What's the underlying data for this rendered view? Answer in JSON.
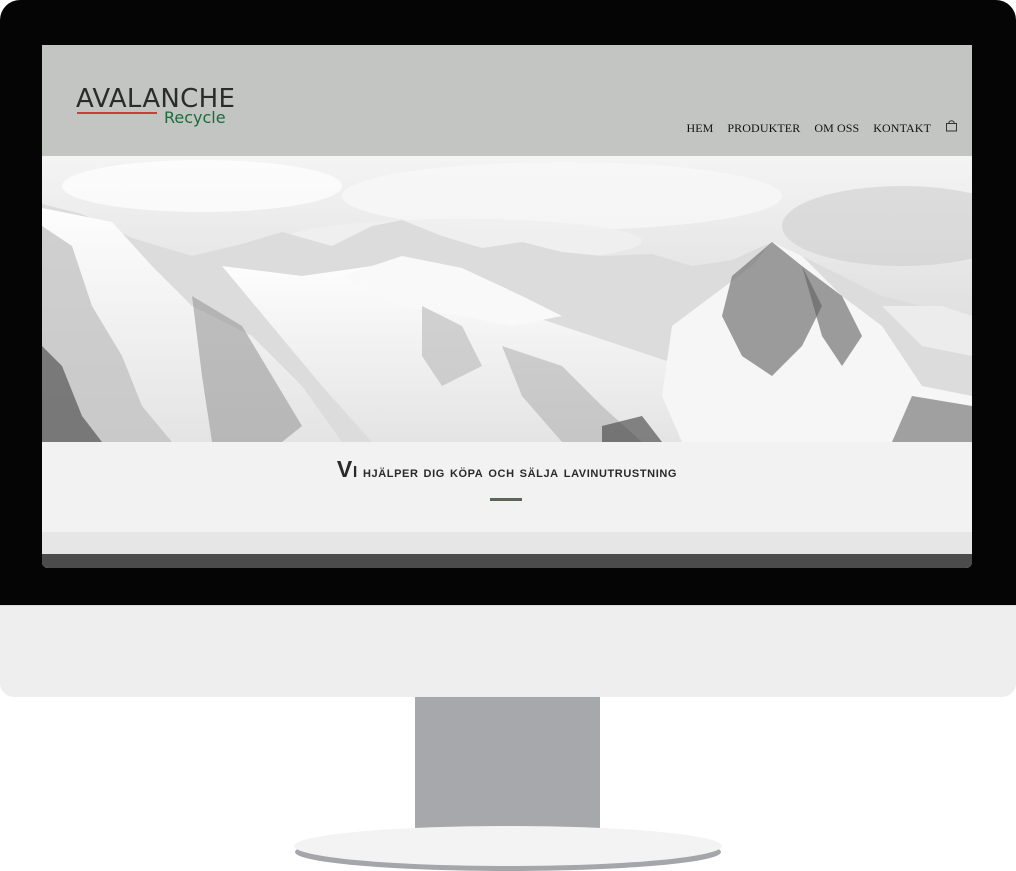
{
  "logo": {
    "top": "AVALANCHE",
    "bottom": "Recycle"
  },
  "nav": {
    "items": [
      "HEM",
      "PRODUKTER",
      "OM OSS",
      "KONTAKT"
    ]
  },
  "hero": {
    "headline_first": "Vi",
    "headline_rest": " hjälper dig köpa och sälja lavinutrustning"
  },
  "colors": {
    "header_bg": "#c2c5c1",
    "logo_green": "#1d6a3a",
    "logo_red": "#c5403c",
    "accent_underline": "#5d6558"
  }
}
